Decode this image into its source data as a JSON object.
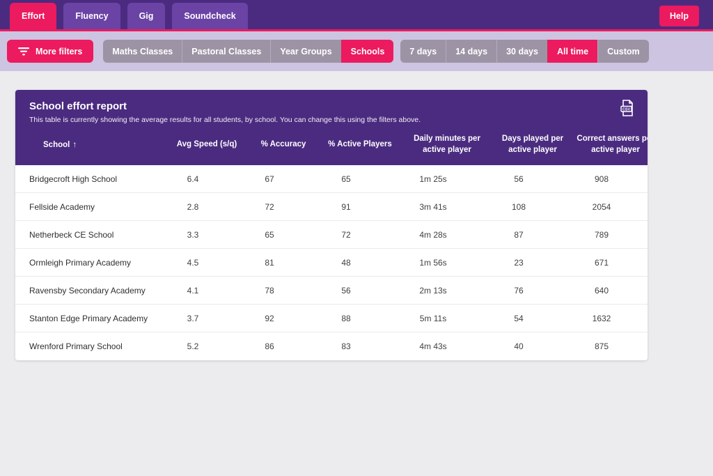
{
  "topbar": {
    "tabs": [
      {
        "label": "Effort",
        "active": true
      },
      {
        "label": "Fluency",
        "active": false
      },
      {
        "label": "Gig",
        "active": false
      },
      {
        "label": "Soundcheck",
        "active": false
      }
    ],
    "help_label": "Help"
  },
  "filters": {
    "more_filters_label": "More filters",
    "group_by": [
      {
        "label": "Maths Classes",
        "active": false
      },
      {
        "label": "Pastoral Classes",
        "active": false
      },
      {
        "label": "Year Groups",
        "active": false
      },
      {
        "label": "Schools",
        "active": true
      }
    ],
    "time_range": [
      {
        "label": "7 days",
        "active": false
      },
      {
        "label": "14 days",
        "active": false
      },
      {
        "label": "30 days",
        "active": false
      },
      {
        "label": "All time",
        "active": true
      },
      {
        "label": "Custom",
        "active": false
      }
    ]
  },
  "report": {
    "title": "School effort report",
    "subtitle": "This table is currently showing the average results for all students, by school. You can change this using the filters above.",
    "csv_icon": "csv-export-icon",
    "sort_indicator": "↑",
    "columns": [
      "School",
      "Avg Speed (s/q)",
      "% Accuracy",
      "% Active Players",
      "Daily minutes per active player",
      "Days played per active player",
      "Correct answers per active player"
    ],
    "rows": [
      [
        "Bridgecroft High School",
        "6.4",
        "67",
        "65",
        "1m 25s",
        "56",
        "908"
      ],
      [
        "Fellside Academy",
        "2.8",
        "72",
        "91",
        "3m 41s",
        "108",
        "2054"
      ],
      [
        "Netherbeck CE School",
        "3.3",
        "65",
        "72",
        "4m 28s",
        "87",
        "789"
      ],
      [
        "Ormleigh Primary Academy",
        "4.5",
        "81",
        "48",
        "1m 56s",
        "23",
        "671"
      ],
      [
        "Ravensby Secondary Academy",
        "4.1",
        "78",
        "56",
        "2m 13s",
        "76",
        "640"
      ],
      [
        "Stanton Edge Primary Academy",
        "3.7",
        "92",
        "88",
        "5m 11s",
        "54",
        "1632"
      ],
      [
        "Wrenford Primary School",
        "5.2",
        "86",
        "83",
        "4m 43s",
        "40",
        "875"
      ]
    ]
  },
  "colors": {
    "accent_pink": "#ec1a5e",
    "primary_purple": "#4b2b80",
    "tab_purple": "#6a43a5",
    "filterbar_lavender": "#cdc4e1",
    "inactive_gray": "#9c94a4",
    "page_background": "#ecebee"
  }
}
